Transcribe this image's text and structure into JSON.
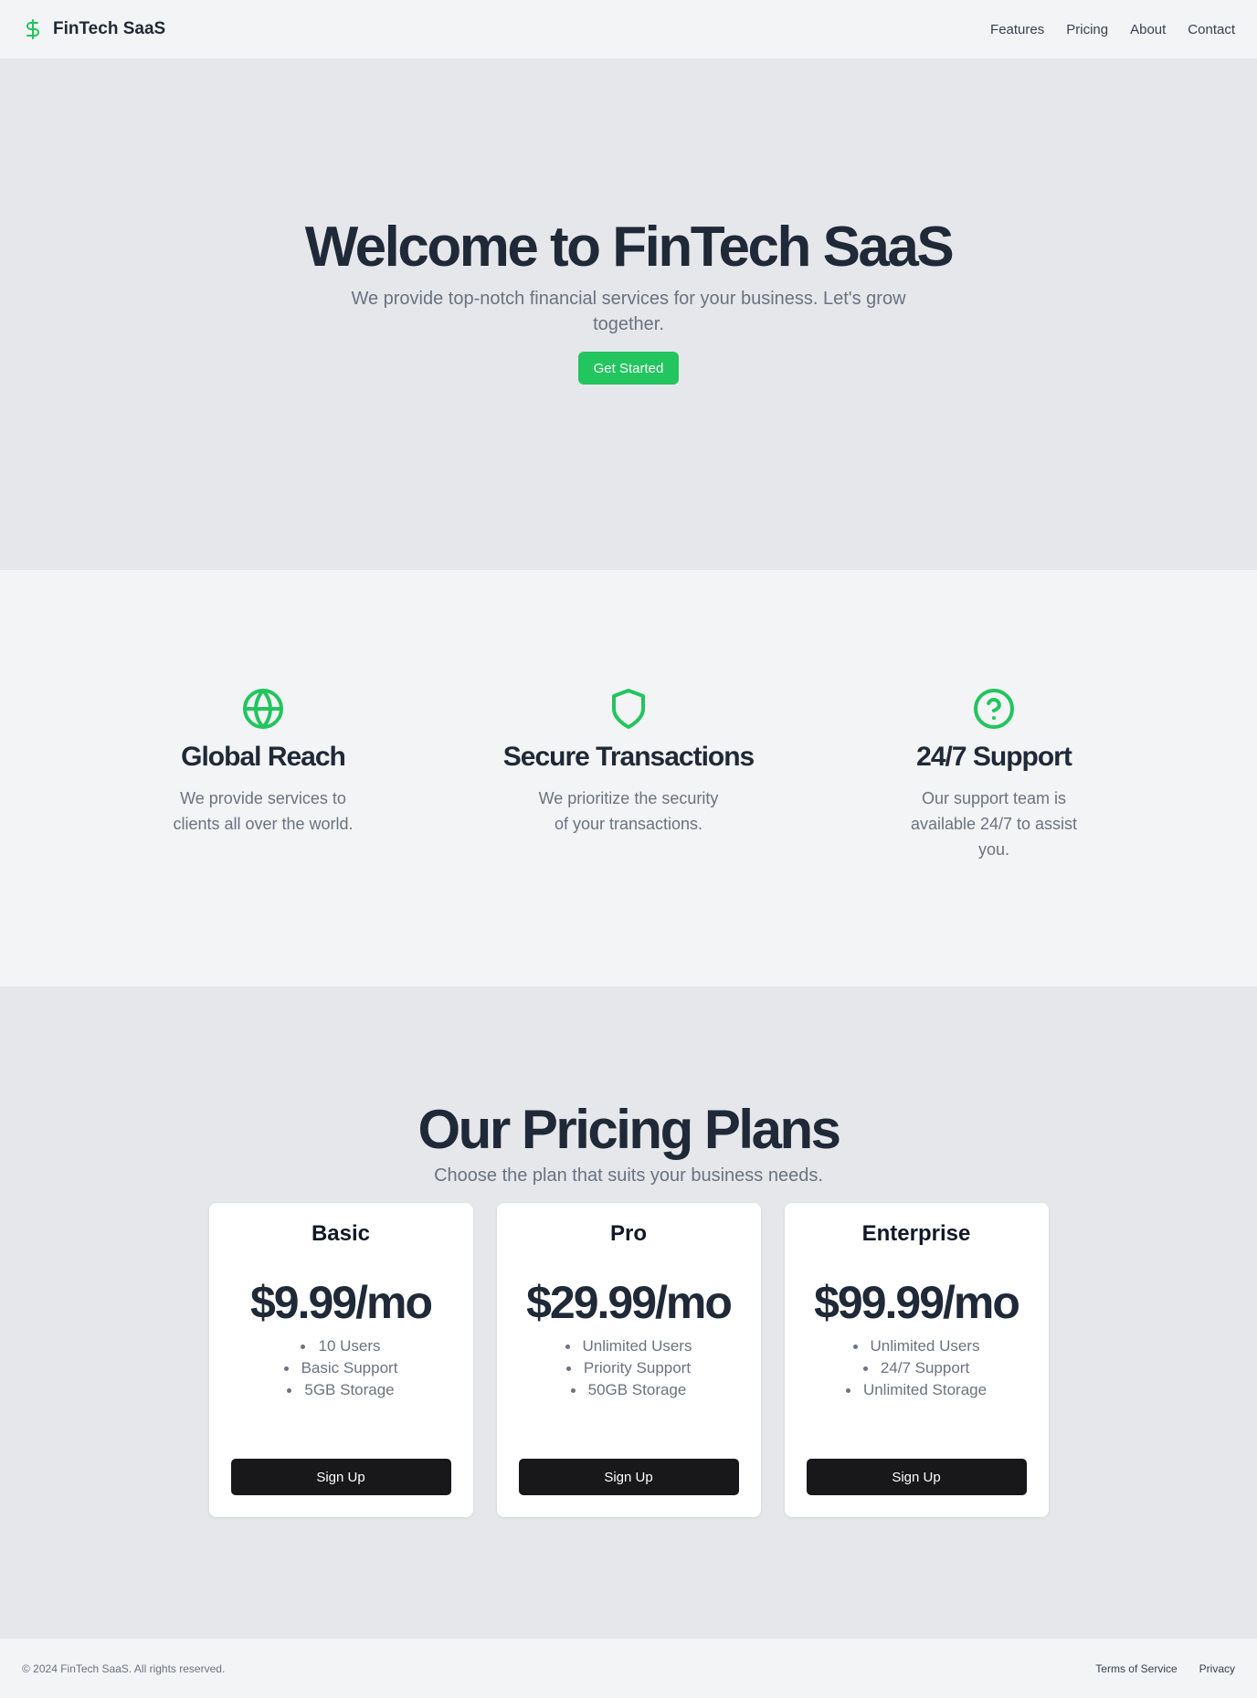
{
  "colors": {
    "accent": "#22c55e",
    "dark_button": "#18181b",
    "heading": "#1f2937",
    "muted_text": "#6b7280",
    "hero_bg": "#e5e7eb",
    "page_bg": "#f3f4f6"
  },
  "header": {
    "brand_icon": "dollar-sign-icon",
    "brand_name": "FinTech SaaS",
    "nav": [
      {
        "label": "Features"
      },
      {
        "label": "Pricing"
      },
      {
        "label": "About"
      },
      {
        "label": "Contact"
      }
    ]
  },
  "hero": {
    "title": "Welcome to FinTech SaaS",
    "subtitle": "We provide top-notch financial services for your business. Let's grow together.",
    "cta_label": "Get Started"
  },
  "features": [
    {
      "icon": "globe-icon",
      "title": "Global Reach",
      "description": "We provide services to clients all over the world."
    },
    {
      "icon": "shield-icon",
      "title": "Secure Transactions",
      "description": "We prioritize the security of your transactions."
    },
    {
      "icon": "help-circle-icon",
      "title": "24/7 Support",
      "description": "Our support team is available 24/7 to assist you."
    }
  ],
  "pricing": {
    "title": "Our Pricing Plans",
    "subtitle": "Choose the plan that suits your business needs.",
    "plans": [
      {
        "name": "Basic",
        "price": "$9.99/mo",
        "features": [
          "10 Users",
          "Basic Support",
          "5GB Storage"
        ],
        "button_label": "Sign Up"
      },
      {
        "name": "Pro",
        "price": "$29.99/mo",
        "features": [
          "Unlimited Users",
          "Priority Support",
          "50GB Storage"
        ],
        "button_label": "Sign Up"
      },
      {
        "name": "Enterprise",
        "price": "$99.99/mo",
        "features": [
          "Unlimited Users",
          "24/7 Support",
          "Unlimited Storage"
        ],
        "button_label": "Sign Up"
      }
    ]
  },
  "footer": {
    "copyright": "© 2024 FinTech SaaS. All rights reserved.",
    "links": [
      {
        "label": "Terms of Service"
      },
      {
        "label": "Privacy"
      }
    ]
  }
}
